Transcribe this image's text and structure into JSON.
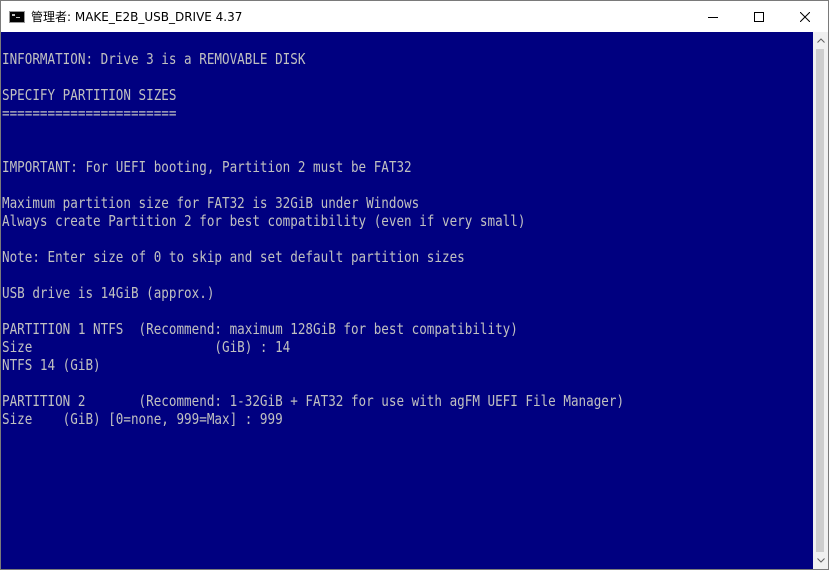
{
  "window": {
    "title": "管理者:  MAKE_E2B_USB_DRIVE 4.37"
  },
  "icons": {
    "app": "console-app-icon",
    "minimize": "minimize-icon",
    "maximize": "maximize-icon",
    "close": "close-icon",
    "scroll_up": "scroll-up-arrow-icon",
    "scroll_down": "scroll-down-arrow-icon"
  },
  "colors": {
    "console_background": "#000080",
    "console_text": "#c0c0c0"
  },
  "console": {
    "lines": [
      "",
      "INFORMATION: Drive 3 is a REMOVABLE DISK",
      "",
      "SPECIFY PARTITION SIZES",
      "=======================",
      "",
      "",
      "IMPORTANT: For UEFI booting, Partition 2 must be FAT32",
      "",
      "Maximum partition size for FAT32 is 32GiB under Windows",
      "Always create Partition 2 for best compatibility (even if very small)",
      "",
      "Note: Enter size of 0 to skip and set default partition sizes",
      "",
      "USB drive is 14GiB (approx.)",
      "",
      "PARTITION 1 NTFS  (Recommend: maximum 128GiB for best compatibility)",
      "Size                        (GiB) : 14",
      "NTFS 14 (GiB)",
      "",
      "PARTITION 2       (Recommend: 1-32GiB + FAT32 for use with agFM UEFI File Manager)",
      "Size    (GiB) [0=none, 999=Max] : 999"
    ]
  }
}
